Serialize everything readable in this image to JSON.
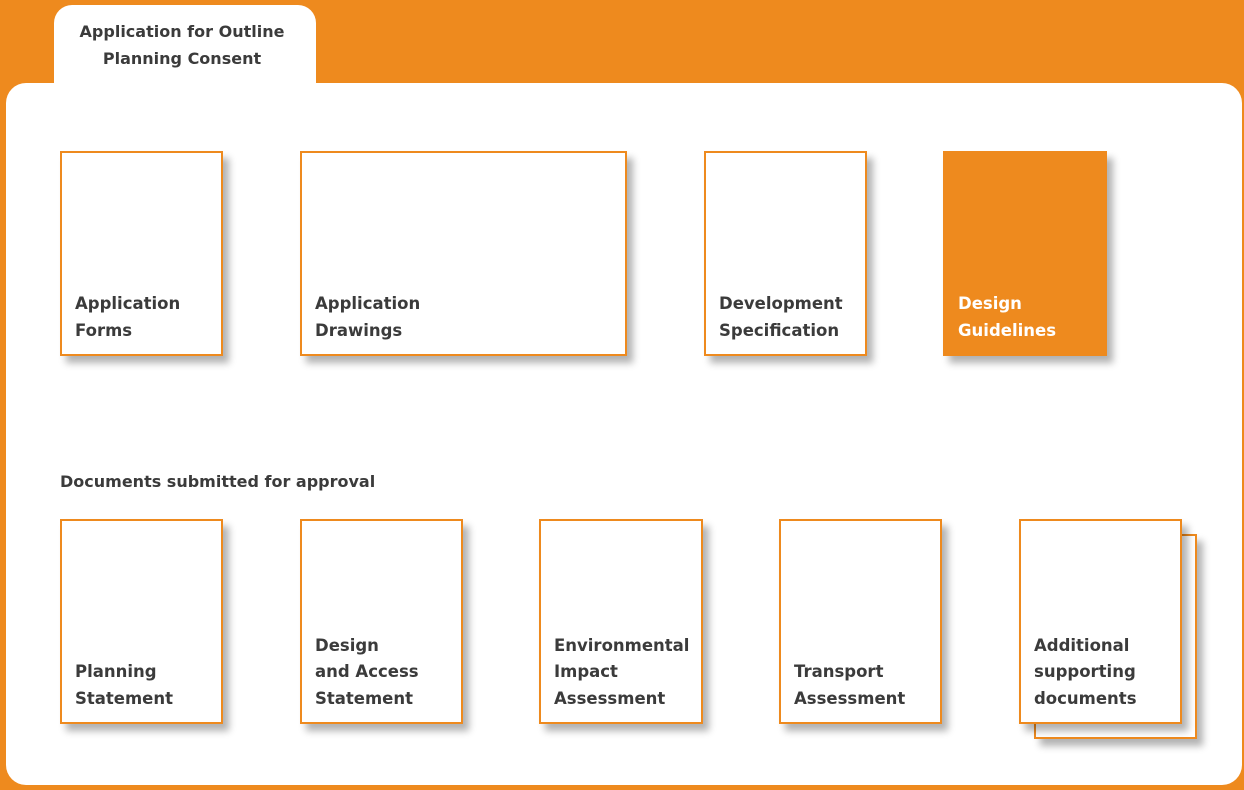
{
  "header": {
    "tab_title": "Application for Outline\nPlanning Consent"
  },
  "top_documents": [
    {
      "label": "Application\nForms",
      "highlighted": false
    },
    {
      "label": "Application\nDrawings",
      "highlighted": false
    },
    {
      "label": "Development\nSpecification",
      "highlighted": false
    },
    {
      "label": "Design\nGuidelines",
      "highlighted": true
    }
  ],
  "section_heading": "Documents submitted for approval",
  "approval_documents": [
    {
      "label": "Planning\nStatement",
      "stacked": false
    },
    {
      "label": "Design\nand Access\nStatement",
      "stacked": false
    },
    {
      "label": "Environmental\nImpact\nAssessment",
      "stacked": false
    },
    {
      "label": "Transport\nAssessment",
      "stacked": false
    },
    {
      "label": "Additional\nsupporting\ndocuments",
      "stacked": true
    }
  ],
  "colors": {
    "accent": "#ee8a1e",
    "text": "#3b3b3b",
    "background": "#ffffff"
  }
}
